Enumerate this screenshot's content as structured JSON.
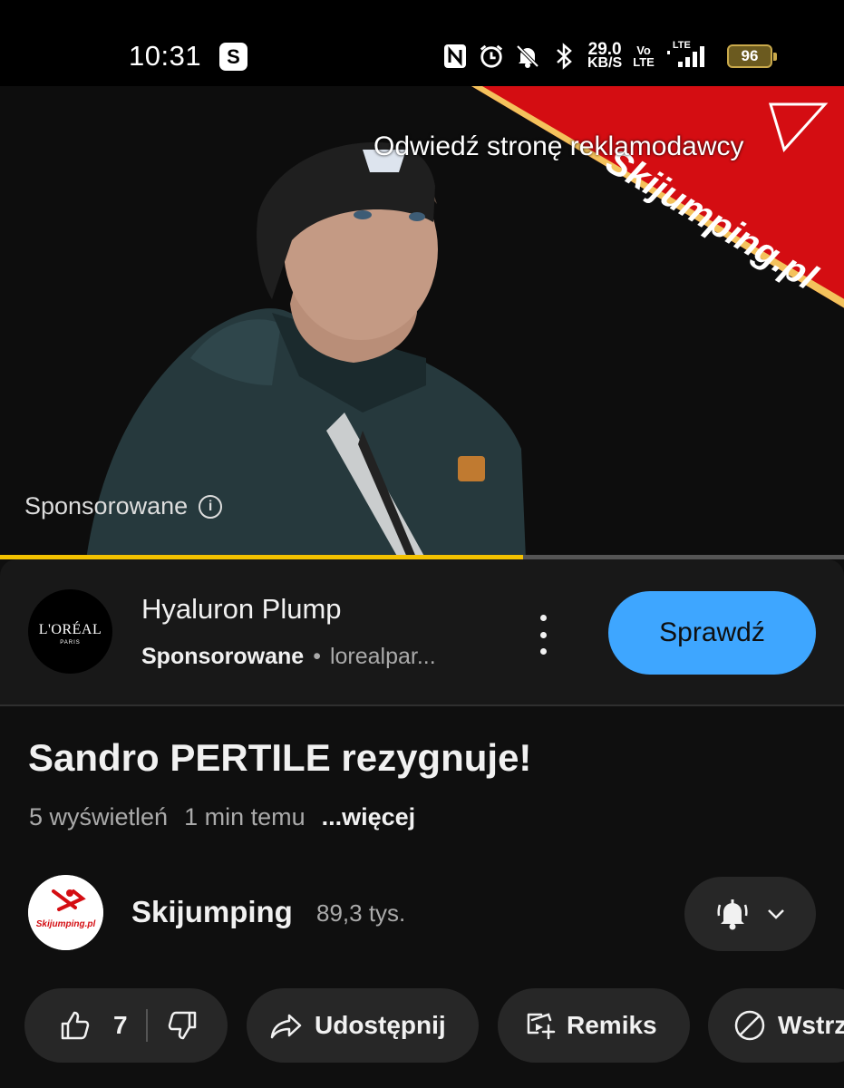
{
  "status_bar": {
    "time": "10:31",
    "app_badge": "S",
    "net_speed": "29.0",
    "net_unit": "KB/S",
    "volte_top": "Vo",
    "volte_bottom": "LTE",
    "lte": "LTE",
    "battery": "96",
    "icons": [
      "nfc-icon",
      "alarm-icon",
      "mute-icon",
      "bluetooth-icon",
      "signal-icon"
    ]
  },
  "ad_overlay": {
    "visit_advertiser": "Odwiedź stronę reklamodawcy",
    "banner_text": "Skijumping.pl",
    "sponsored_label": "Sponsorowane",
    "progress": 0.62
  },
  "ad_card": {
    "logo_text": "L'ORÉAL",
    "logo_sub": "PARIS",
    "title": "Hyaluron Plump",
    "sponsored": "Sponsorowane",
    "separator": "•",
    "domain": "lorealpar...",
    "cta": "Sprawdź"
  },
  "video": {
    "title": "Sandro PERTILE rezygnuje!",
    "views": "5 wyświetleń",
    "time_ago": "1 min temu",
    "more": "...więcej"
  },
  "channel": {
    "name": "Skijumping",
    "subscribers": "89,3 tys.",
    "avatar_text": "Skijumping.pl"
  },
  "actions": {
    "likes": "7",
    "share": "Udostępnij",
    "remix": "Remiks",
    "download": "Wstrz"
  },
  "colors": {
    "background": "#0f0f0f",
    "cta": "#3ea6ff",
    "progress": "#f3c200",
    "banner_red": "#d40d12"
  }
}
